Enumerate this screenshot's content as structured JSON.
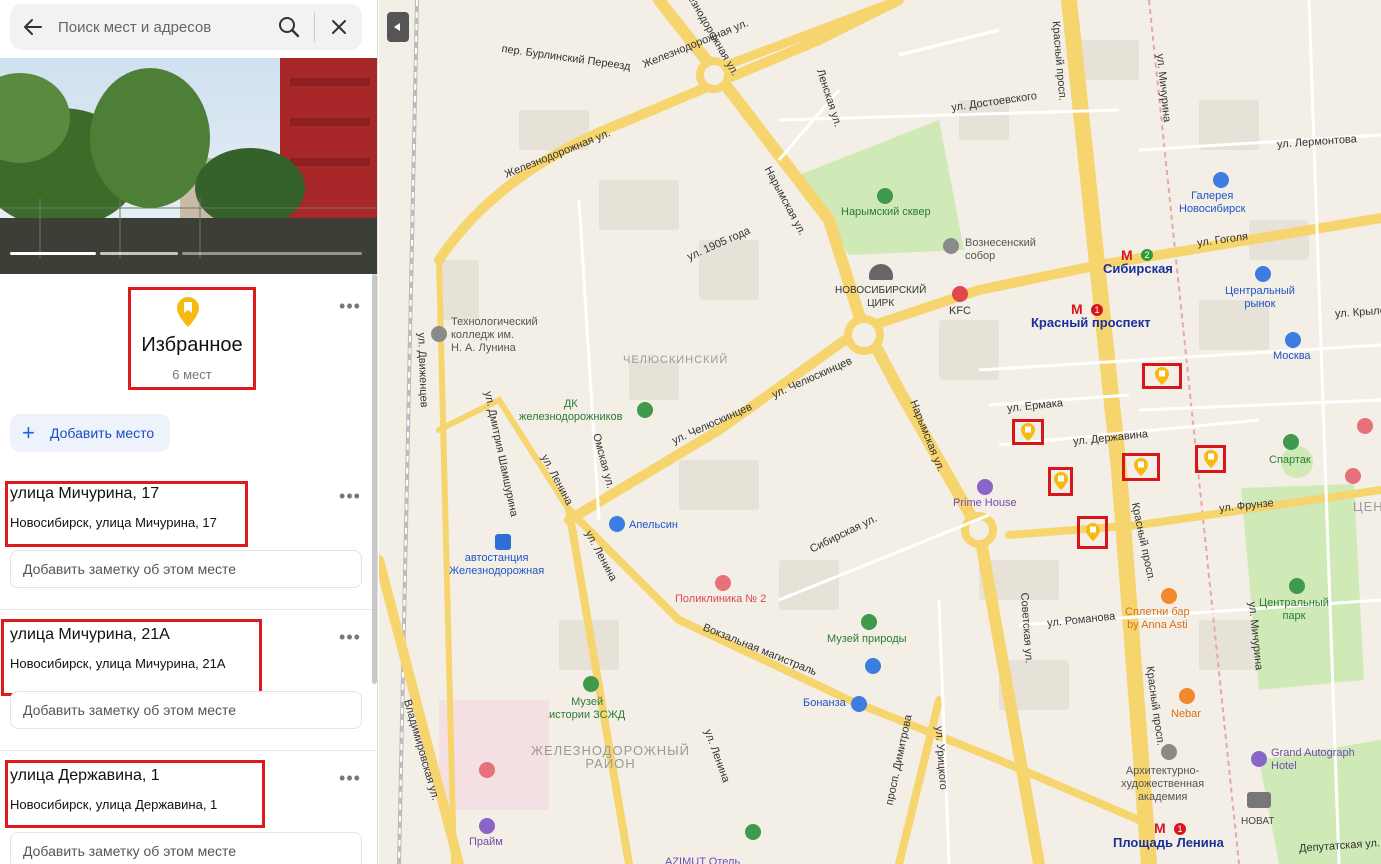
{
  "search": {
    "placeholder": "Поиск мест и адресов"
  },
  "collection": {
    "title": "Избранное",
    "count": "6 мест"
  },
  "add_place_label": "Добавить место",
  "places": [
    {
      "title": "улица Мичурина, 17",
      "address": "Новосибирск, улица Мичурина, 17",
      "note_placeholder": "Добавить заметку об этом месте"
    },
    {
      "title": "улица Мичурина, 21А",
      "address": "Новосибирск, улица Мичурина, 21А",
      "note_placeholder": "Добавить заметку об этом месте"
    },
    {
      "title": "улица Державина, 1",
      "address": "Новосибирск, улица Державина, 1",
      "note_placeholder": "Добавить заметку об этом месте"
    }
  ],
  "map": {
    "streets": {
      "zheleznodorozhnaya_top": "Железнодорожная ул.",
      "zheleznodorozhnaya_mid": "Железнодорожная ул.",
      "zheleznodorozhnaya_left": "Железнодорожная ул.",
      "burlinsky": "пер. Бурлинский Переезд",
      "lenskaya": "Ленская ул.",
      "dostoevskogo": "ул. Достоевского",
      "krasny_top": "Красный просп.",
      "michurina_top": "ул. Мичурина",
      "lermontova": "ул. Лермонтова",
      "narymskaya_top": "Нарымская ул.",
      "ul1905": "ул. 1905 года",
      "gogolya": "ул. Гоголя",
      "krylova": "ул. Крылова",
      "chelyuskintsev_1": "ул. Челюскинцев",
      "chelyuskintsev_2": "ул. Челюскинцев",
      "dvizhentsev": "ул. Движенцев",
      "shamshurina": "ул. Дмитрия Шамшурина",
      "omskaya": "Омская ул.",
      "lenina_1": "ул. Ленина",
      "lenina_2": "ул. Ленина",
      "lenina_3": "ул. Ленина",
      "narymskaya_bottom": "Нарымская ул.",
      "ermaka": "ул. Ермака",
      "derzhavina": "ул. Державина",
      "frunze": "ул. Фрунзе",
      "sibirskaya": "Сибирская ул.",
      "sovetskaya": "Советская ул.",
      "romanova": "ул. Романова",
      "krasny_bottom": "Красный просп.",
      "michurina_bottom": "ул. Мичурина",
      "vokzalnaya": "Вокзальная магистраль",
      "vladimirovskaya": "Владимировская ул.",
      "dimitrova": "просп. Димитрова",
      "urickogo": "ул. Урицкого",
      "deputatskaya": "Депутатская ул."
    },
    "pois": {
      "galereya": "Галерея\nНовосибирск",
      "narymsky_skver": "Нарымский сквер",
      "voznesensky": "Вознесенский\nсобор",
      "tsirk": "НОВОСИБИРСКИЙ\nЦИРК",
      "kfc": "KFC",
      "sibirskaya_metro": "Сибирская",
      "krasny_metro": "Красный проспект",
      "tsentralny_rynok": "Центральный\nрынок",
      "tekh_kolledzh": "Технологический\nколледж им.\nН. А. Лунина",
      "chelyuskinsky": "ЧЕЛЮСКИНСКИЙ",
      "dk": "ДК\nжелезнодорожников",
      "moskva": "Москва",
      "spartak": "Спартак",
      "prime_house": "Prime House",
      "tsentr": "ЦЕНТ",
      "avtostantsiya": "автостанция\nЖелезнодорожная",
      "apelsin": "Апельсин",
      "poliklinika": "Поликлиника № 2",
      "spletni": "Сплетни бар\nby Anna Asti",
      "tsentralny_park": "Центральный\nпарк",
      "muzey_prirody": "Музей природы",
      "muzey_zszhd": "Музей\nистории ЗСЖД",
      "bonanza": "Бонанза",
      "nebar": "Nebar",
      "zheleznodorozhny_rayon": "ЖЕЛЕЗНОДОРОЖНЫЙ\nРАЙОН",
      "grand_autograph": "Grand Autograph\nHotel",
      "arkh_akademiya": "Архитектурно-\nхудожественная\nакадемия",
      "novat": "НОВАТ",
      "pl_lenina": "Площадь Ленина",
      "praym": "Прайм",
      "azimut": "AZIMUT Отель"
    },
    "metro_badges": {
      "sibirskaya": "2",
      "krasny": "1",
      "pl_lenina": "1"
    }
  },
  "colors": {
    "accent_red": "#e0191f",
    "pin_yellow": "#f7b90d",
    "link_blue": "#1a4dc4",
    "road_yellow": "#f7d56e",
    "park_green": "#cfeab7"
  }
}
